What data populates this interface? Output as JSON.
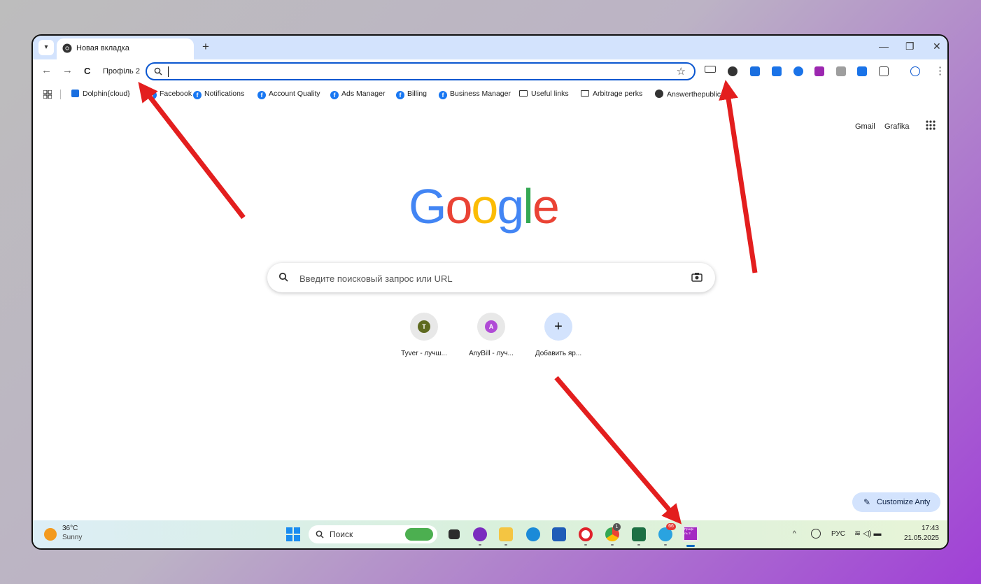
{
  "colors": {
    "accent": "#0b57d0",
    "arrow": "#e31e1e",
    "google_blue": "#4285f4",
    "google_red": "#ea4335",
    "google_yellow": "#fbbc05",
    "google_green": "#34a853",
    "facebook": "#1877f2"
  },
  "browser": {
    "tab_title": "Новая вкладка",
    "new_tab": "+",
    "profile_label": "Профіль 2",
    "minimize": "—",
    "restore": "❐",
    "close": "✕",
    "back": "←",
    "forward": "→",
    "reload": "C",
    "star": "☆",
    "menu": "⋮"
  },
  "bookmarks": [
    {
      "label": "Dolphin{cloud}",
      "icon": "dolphin-icon"
    },
    {
      "label": "Facebook",
      "icon": "facebook-icon"
    },
    {
      "label": "Notifications",
      "icon": "facebook-icon"
    },
    {
      "label": "Account Quality",
      "icon": "facebook-icon"
    },
    {
      "label": "Ads Manager",
      "icon": "facebook-icon"
    },
    {
      "label": "Billing",
      "icon": "facebook-icon"
    },
    {
      "label": "Business Manager",
      "icon": "facebook-icon"
    },
    {
      "label": "Useful links",
      "icon": "folder-icon"
    },
    {
      "label": "Arbitrage perks",
      "icon": "folder-icon"
    },
    {
      "label": "Answerthepublic",
      "icon": "globe-icon"
    }
  ],
  "page": {
    "gmail": "Gmail",
    "images": "Grafika",
    "logo": [
      "G",
      "o",
      "o",
      "g",
      "l",
      "e"
    ],
    "search_placeholder": "Введите поисковый запрос или URL",
    "shortcuts": [
      {
        "initial": "T",
        "label": "Tyver - лучш...",
        "color": "#5e6a1f"
      },
      {
        "initial": "A",
        "label": "AnyBill - луч...",
        "color": "#b04bd6"
      },
      {
        "initial": "+",
        "label": "Добавить яр...",
        "color": "#d3e3fd"
      }
    ],
    "customize": "Customize Anty"
  },
  "taskbar": {
    "temp": "36°C",
    "weather": "Sunny",
    "search": "Поиск",
    "lang": "РУС",
    "time": "17:43",
    "date": "21.05.2025",
    "chrome_badge": "1",
    "telegram_badge": "66",
    "profile_app_label": "Профі ль 2"
  }
}
